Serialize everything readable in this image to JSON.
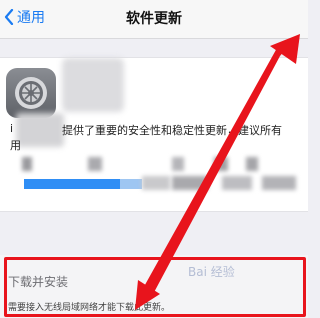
{
  "navbar": {
    "back_label": "通用",
    "title": "软件更新"
  },
  "update": {
    "description_fragment": "提供了重要的安全性和稳定性更新，建议所有",
    "line_start_1": "i",
    "line_start_2": "用"
  },
  "download_section": {
    "label": "下载并安装",
    "note": "需要接入无线局域网络才能下载此更新。"
  },
  "watermark": {
    "text": "Bai 经验"
  },
  "colors": {
    "accent": "#1a7bf2",
    "annotation_red": "#e8141c"
  }
}
